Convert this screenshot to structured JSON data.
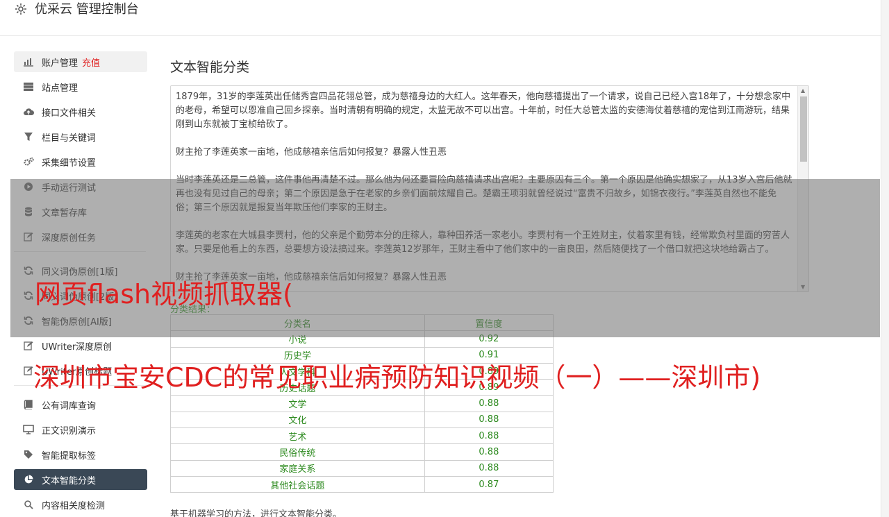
{
  "app": {
    "title": "优采云 管理控制台",
    "logo_icon": "gear-icon"
  },
  "sidebar": {
    "items": [
      {
        "label": "账户管理",
        "badge": "充值",
        "icon": "bar-chart-icon"
      },
      {
        "label": "站点管理",
        "icon": "server-icon"
      },
      {
        "label": "接口文件相关",
        "icon": "cloud-upload-icon"
      },
      {
        "label": "栏目与关键词",
        "icon": "filter-icon"
      },
      {
        "label": "采集细节设置",
        "icon": "gears-icon"
      },
      {
        "label": "手动运行测试",
        "icon": "play-icon"
      },
      {
        "label": "文章暂存库",
        "icon": "database-icon"
      },
      {
        "label": "深度原创任务",
        "icon": "edit-icon"
      },
      {
        "label": "同义词伪原创[1版]",
        "icon": "refresh-icon"
      },
      {
        "label": "同义词伪原创[2版]",
        "icon": "refresh-icon"
      },
      {
        "label": "智能伪原创[AI版]",
        "icon": "refresh-icon"
      },
      {
        "label": "UWriter深度原创",
        "icon": "edit-icon"
      },
      {
        "label": "UWriter原创标题",
        "icon": "edit-icon"
      },
      {
        "label": "公有词库查询",
        "icon": "book-icon"
      },
      {
        "label": "正文识别演示",
        "icon": "monitor-icon"
      },
      {
        "label": "智能提取标签",
        "icon": "tag-icon"
      },
      {
        "label": "文本智能分类",
        "icon": "pie-chart-icon"
      },
      {
        "label": "内容相关度检测",
        "icon": "search-icon"
      }
    ]
  },
  "main": {
    "title": "文本智能分类",
    "text_paragraphs": [
      "1879年，31岁的李莲英出任储秀宫四品花翎总管，成为慈禧身边的大红人。这年春天，他向慈禧提出了一个请求，说自己已经入宫18年了，十分想念家中的老母，希望可以恩准自己回乡探亲。当时清朝有明确的规定，太监无故不可以出宫。十年前，时任大总管太监的安德海仗着慈禧的宠信到江南游玩，结果刚到山东就被丁宝桢给砍了。",
      "财主抢了李莲英家一亩地，他成慈禧亲信后如何报复？暴露人性丑恶",
      "当时李莲英还是二总管，这件事他再清楚不过。那么他为何还要冒险向慈禧请求出宫呢？主要原因有三个。第一个原因是他确实想家了，从13岁入宫后他就再也没有见过自己的母亲；第二个原因是急于在老家的乡亲们面前炫耀自己。楚霸王项羽就曾经说过“富贵不归故乡，如锦衣夜行。”李莲英自然也不能免俗；第三个原因就是报复当年欺压他们李家的王财主。",
      "李莲英的老家在大城县李贾村，他的父亲是个勤劳本分的庄稼人，靠种田养活一家老小。李贾村有一个王姓财主，仗着家里有钱，经常欺负村里面的穷苦人家。只要是他看上的东西，总要想方设法搞过来。李莲英12岁那年，王财主看中了他们家中的一亩良田，然后随便找了一个借口就把这块地给霸占了。",
      "财主抢了李莲英家一亩地，他成慈禧亲信后如何报复？暴露人性丑恶"
    ],
    "result_label": "分类结果：",
    "table": {
      "headers": [
        "分类名",
        "置信度"
      ],
      "rows": [
        [
          "小说",
          "0.92"
        ],
        [
          "历史学",
          "0.91"
        ],
        [
          "人文学科",
          "0.89"
        ],
        [
          "历史话题",
          "0.89"
        ],
        [
          "文学",
          "0.88"
        ],
        [
          "文化",
          "0.88"
        ],
        [
          "艺术",
          "0.88"
        ],
        [
          "民俗传统",
          "0.88"
        ],
        [
          "家庭关系",
          "0.88"
        ],
        [
          "其他社会话题",
          "0.87"
        ]
      ]
    },
    "footnote": "基于机器学习的方法，进行文本智能分类。"
  },
  "overlay": {
    "line1": "网页flash视频抓取器(",
    "line2": "深圳市宝安CDC的常见职业病预防知识视频（一）——深圳市)"
  },
  "colors": {
    "active_bg": "#3a4856",
    "accent_red": "#e02020",
    "result_green": "#2d8a1f"
  }
}
